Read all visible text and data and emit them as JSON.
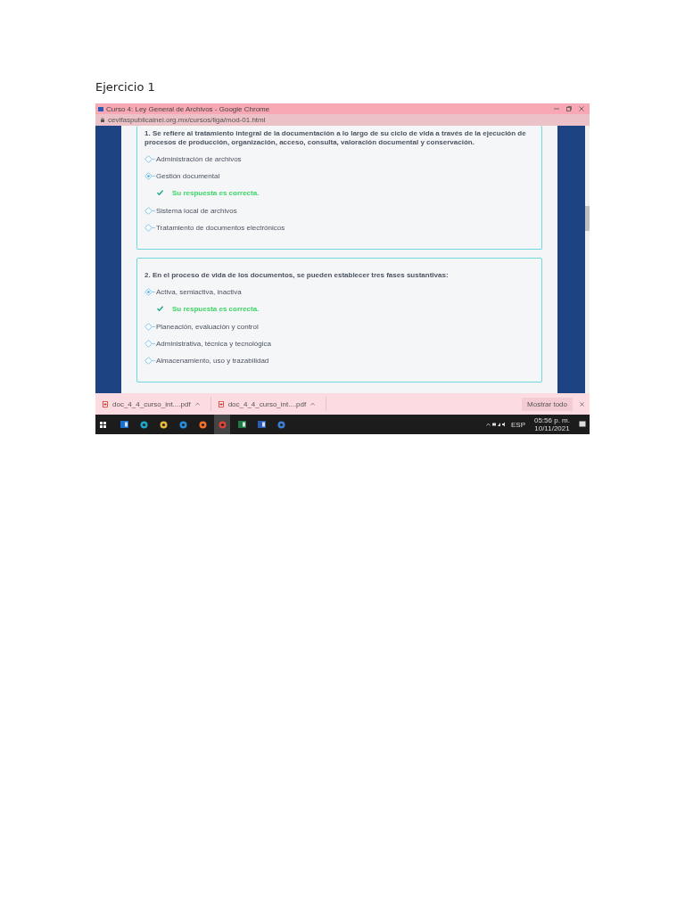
{
  "document": {
    "heading": "Ejercicio 1"
  },
  "browser": {
    "title": "Curso 4: Ley General de Archivos - Google Chrome",
    "url": "cevifaspublicainei.org.mx/cursos/liga/mod-01.html"
  },
  "questions": [
    {
      "text": "1. Se refiere al tratamiento integral de la documentación a lo largo de su ciclo de vida a través de la ejecución de procesos de producción, organización, acceso, consulta, valoración documental y conservación.",
      "items": [
        {
          "kind": "option",
          "label": "Administración de archivos",
          "selected": false
        },
        {
          "kind": "option",
          "label": "Gestión documental",
          "selected": true
        },
        {
          "kind": "feedback",
          "label": "Su respuesta es correcta."
        },
        {
          "kind": "option",
          "label": "Sistema local de archivos",
          "selected": false
        },
        {
          "kind": "option",
          "label": "Tratamiento de documentos electrónicos",
          "selected": false
        }
      ]
    },
    {
      "text": "2. En el proceso de vida de los documentos, se pueden establecer tres fases sustantivas:",
      "items": [
        {
          "kind": "option",
          "label": "Activa, semiactiva, inactiva",
          "selected": true
        },
        {
          "kind": "feedback",
          "label": "Su respuesta es correcta."
        },
        {
          "kind": "option",
          "label": "Planeación, evaluación y control",
          "selected": false
        },
        {
          "kind": "option",
          "label": "Administrativa, técnica y tecnológica",
          "selected": false
        },
        {
          "kind": "option",
          "label": "Almacenamiento, uso y trazabilidad",
          "selected": false
        }
      ]
    }
  ],
  "downloads": [
    {
      "name": "doc_4_4_curso_int....pdf"
    },
    {
      "name": "doc_4_4_curso_int....pdf"
    }
  ],
  "downloads_bar": {
    "show_all": "Mostrar todo"
  },
  "taskbar": {
    "apps": [
      {
        "kind": "outlook",
        "selected": false
      },
      {
        "kind": "edge",
        "selected": false
      },
      {
        "kind": "explorer",
        "selected": false
      },
      {
        "kind": "ie",
        "selected": false
      },
      {
        "kind": "firefox",
        "selected": false
      },
      {
        "kind": "chrome",
        "selected": true
      },
      {
        "kind": "excel",
        "selected": false
      },
      {
        "kind": "word",
        "selected": false
      },
      {
        "kind": "photos",
        "selected": false
      }
    ],
    "language": "ESP",
    "time": "05:56 p. m.",
    "date": "10/11/2021"
  }
}
